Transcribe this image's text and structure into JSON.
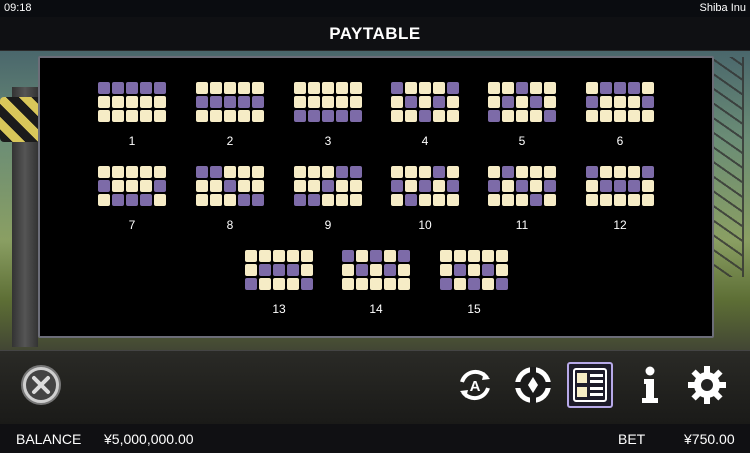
{
  "status_bar": {
    "time": "09:18",
    "app_name": "Shiba Inu"
  },
  "header": {
    "title": "PAYTABLE"
  },
  "paylines": [
    {
      "number": "1",
      "active_cells": [
        [
          0,
          0
        ],
        [
          0,
          1
        ],
        [
          0,
          2
        ],
        [
          0,
          3
        ],
        [
          0,
          4
        ]
      ]
    },
    {
      "number": "2",
      "active_cells": [
        [
          1,
          0
        ],
        [
          1,
          1
        ],
        [
          1,
          2
        ],
        [
          1,
          3
        ],
        [
          1,
          4
        ]
      ]
    },
    {
      "number": "3",
      "active_cells": [
        [
          2,
          0
        ],
        [
          2,
          1
        ],
        [
          2,
          2
        ],
        [
          2,
          3
        ],
        [
          2,
          4
        ]
      ]
    },
    {
      "number": "4",
      "active_cells": [
        [
          0,
          0
        ],
        [
          1,
          1
        ],
        [
          2,
          2
        ],
        [
          1,
          3
        ],
        [
          0,
          4
        ]
      ]
    },
    {
      "number": "5",
      "active_cells": [
        [
          2,
          0
        ],
        [
          1,
          1
        ],
        [
          0,
          2
        ],
        [
          1,
          3
        ],
        [
          2,
          4
        ]
      ]
    },
    {
      "number": "6",
      "active_cells": [
        [
          1,
          0
        ],
        [
          0,
          1
        ],
        [
          0,
          2
        ],
        [
          0,
          3
        ],
        [
          1,
          4
        ]
      ]
    },
    {
      "number": "7",
      "active_cells": [
        [
          1,
          0
        ],
        [
          2,
          1
        ],
        [
          2,
          2
        ],
        [
          2,
          3
        ],
        [
          1,
          4
        ]
      ]
    },
    {
      "number": "8",
      "active_cells": [
        [
          0,
          0
        ],
        [
          0,
          1
        ],
        [
          1,
          2
        ],
        [
          2,
          3
        ],
        [
          2,
          4
        ]
      ]
    },
    {
      "number": "9",
      "active_cells": [
        [
          2,
          0
        ],
        [
          2,
          1
        ],
        [
          1,
          2
        ],
        [
          0,
          3
        ],
        [
          0,
          4
        ]
      ]
    },
    {
      "number": "10",
      "active_cells": [
        [
          1,
          0
        ],
        [
          2,
          1
        ],
        [
          1,
          2
        ],
        [
          0,
          3
        ],
        [
          1,
          4
        ]
      ]
    },
    {
      "number": "11",
      "active_cells": [
        [
          1,
          0
        ],
        [
          0,
          1
        ],
        [
          1,
          2
        ],
        [
          2,
          3
        ],
        [
          1,
          4
        ]
      ]
    },
    {
      "number": "12",
      "active_cells": [
        [
          0,
          0
        ],
        [
          1,
          1
        ],
        [
          1,
          2
        ],
        [
          1,
          3
        ],
        [
          0,
          4
        ]
      ]
    },
    {
      "number": "13",
      "active_cells": [
        [
          2,
          0
        ],
        [
          1,
          1
        ],
        [
          1,
          2
        ],
        [
          1,
          3
        ],
        [
          2,
          4
        ]
      ]
    },
    {
      "number": "14",
      "active_cells": [
        [
          0,
          0
        ],
        [
          1,
          1
        ],
        [
          0,
          2
        ],
        [
          1,
          3
        ],
        [
          0,
          4
        ]
      ]
    },
    {
      "number": "15",
      "active_cells": [
        [
          2,
          0
        ],
        [
          1,
          1
        ],
        [
          2,
          2
        ],
        [
          1,
          3
        ],
        [
          2,
          4
        ]
      ]
    }
  ],
  "toolbar": {
    "close_icon": "close-circle-icon",
    "autoplay_icon": "autoplay-icon",
    "chip_icon": "chip-icon",
    "paytable_icon": "paytable-icon",
    "info_icon": "info-icon",
    "settings_icon": "gear-icon"
  },
  "bottom_bar": {
    "balance_label": "BALANCE",
    "balance_value": "¥5,000,000.00",
    "bet_label": "BET",
    "bet_value": "¥750.00"
  },
  "colors": {
    "cell_off": "#f6ecc6",
    "cell_on": "#7d6ba8",
    "active_button_border": "#b7a9e8"
  }
}
